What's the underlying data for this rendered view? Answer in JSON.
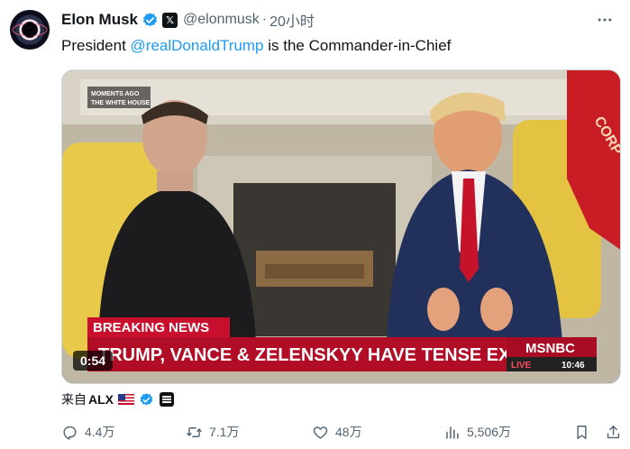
{
  "author": {
    "name": "Elon Musk",
    "handle": "@elonmusk",
    "separator": "·",
    "time": "20小时",
    "x_badge": "𝕏"
  },
  "tweet": {
    "text_before": "President ",
    "mention": "@realDonaldTrump",
    "text_after": " is the Commander-in-Chief"
  },
  "media": {
    "corner_line1": "MOMENTS AGO",
    "corner_line2": "THE WHITE HOUSE",
    "breaking_label": "BREAKING NEWS",
    "headline": "TRUMP, VANCE & ZELENSKYY HAVE TENSE EXCHANGE",
    "network": "MSNBC",
    "live_label": "LIVE",
    "live_time": "10:46",
    "flag_text": "CORP",
    "duration": "0:54"
  },
  "source": {
    "prefix": "来自",
    "name": "ALX"
  },
  "actions": {
    "replies": "4.4万",
    "reposts": "7.1万",
    "likes": "48万",
    "views": "5,506万"
  },
  "colors": {
    "verified_blue": "#1d9bf0",
    "mention_blue": "#1d9bf0",
    "muted": "#536471",
    "breaking_red": "#c8102e"
  },
  "icons": {
    "more": "more-icon",
    "reply": "reply-icon",
    "repost": "repost-icon",
    "like": "heart-icon",
    "views": "views-icon",
    "bookmark": "bookmark-icon",
    "share": "share-icon"
  }
}
